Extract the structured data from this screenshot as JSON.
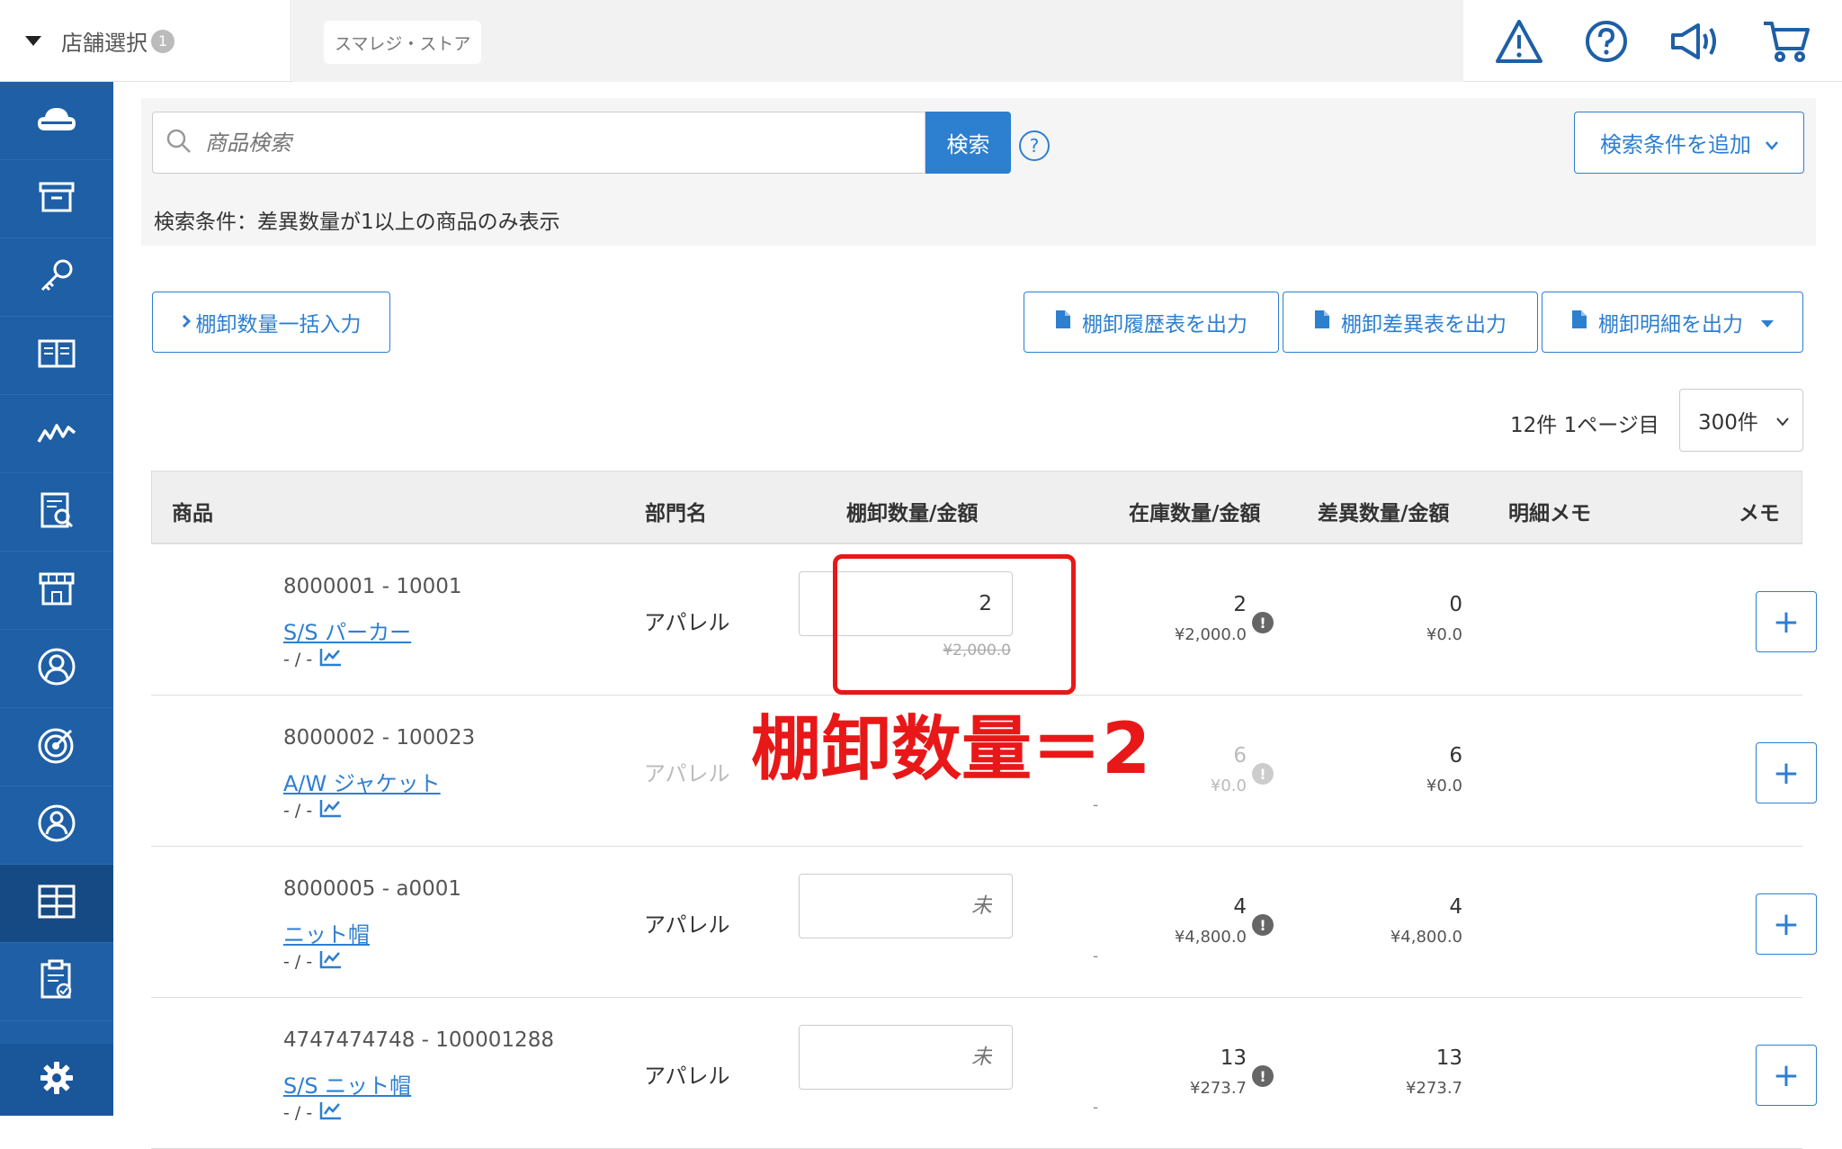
{
  "topbar": {
    "store_select_label": "店舗選択",
    "store_count": "1",
    "store_chip": "スマレジ・ストア",
    "icons": [
      "warning-icon",
      "help-icon",
      "megaphone-icon",
      "cart-icon"
    ]
  },
  "sidebar": {
    "items": [
      "cloud-icon",
      "archive-icon",
      "key-icon",
      "book-icon",
      "chart-line-icon",
      "report-icon",
      "store-icon",
      "user-circle-icon",
      "target-icon",
      "person-icon",
      "inventory-icon",
      "clipboard-icon"
    ],
    "active_index": 10,
    "settings_icon": "gear-icon"
  },
  "search": {
    "placeholder": "商品検索",
    "button_label": "検索",
    "help_label": "?",
    "add_condition_label": "検索条件を追加",
    "condition_text": "検索条件：差異数量が1以上の商品のみ表示"
  },
  "actions": {
    "bulk_input_label": "棚卸数量一括入力",
    "export_history_label": "棚卸履歴表を出力",
    "export_diff_label": "棚卸差異表を出力",
    "export_detail_label": "棚卸明細を出力"
  },
  "pager": {
    "summary": "12件 1ページ目",
    "per_page": "300件"
  },
  "table": {
    "headers": {
      "product": "商品",
      "dept": "部門名",
      "count": "棚卸数量/金額",
      "stock": "在庫数量/金額",
      "diff": "差異数量/金額",
      "detail_memo": "明細メモ",
      "memo": "メモ"
    },
    "rows": [
      {
        "code": "8000001 - 10001",
        "name": "S/S パーカー",
        "sub": "- / -",
        "dept": "アパレル",
        "count_value": "2",
        "count_placeholder": "",
        "count_amount": "¥2,000.0",
        "stock_qty": "2",
        "stock_amt": "¥2,000.0",
        "diff_qty": "0",
        "diff_amt": "¥0.0",
        "add_memo": "+"
      },
      {
        "code": "8000002 - 100023",
        "name": "A/W ジャケット",
        "sub": "- / -",
        "dept": "アパレル",
        "count_value": "",
        "count_placeholder": "",
        "count_amount": "-",
        "stock_qty": "6",
        "stock_amt": "¥0.0",
        "diff_qty": "6",
        "diff_amt": "¥0.0",
        "add_memo": "+"
      },
      {
        "code": "8000005 - a0001",
        "name": "ニット帽",
        "sub": "- / -",
        "dept": "アパレル",
        "count_value": "",
        "count_placeholder": "未",
        "count_amount": "-",
        "stock_qty": "4",
        "stock_amt": "¥4,800.0",
        "diff_qty": "4",
        "diff_amt": "¥4,800.0",
        "add_memo": "+"
      },
      {
        "code": "4747474748 - 100001288",
        "name": "S/S ニット帽",
        "sub": "- / -",
        "dept": "アパレル",
        "count_value": "",
        "count_placeholder": "未",
        "count_amount": "-",
        "stock_qty": "13",
        "stock_amt": "¥273.7",
        "diff_qty": "13",
        "diff_amt": "¥273.7",
        "add_memo": "+"
      }
    ]
  },
  "annotation": {
    "text": "棚卸数量＝2",
    "color": "#e81818"
  },
  "colors": {
    "sidebar": "#1e5fa6",
    "accent": "#2d7fd0"
  }
}
